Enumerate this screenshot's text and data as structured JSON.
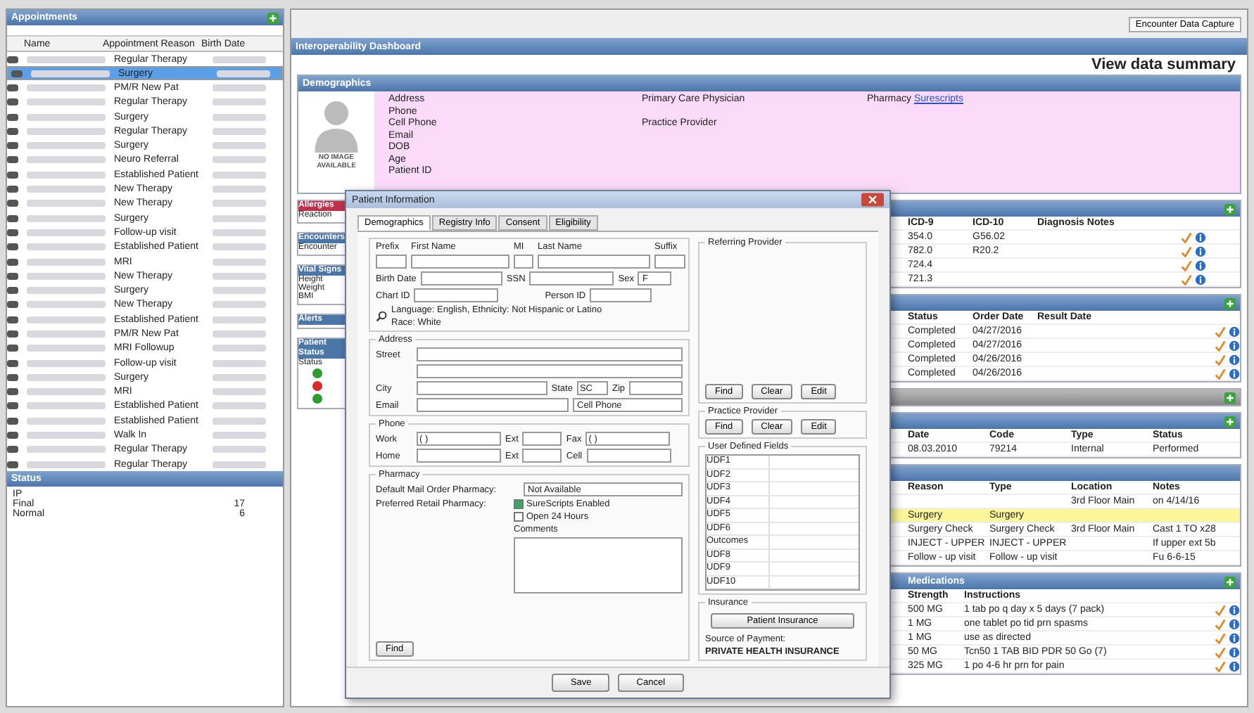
{
  "appointments": {
    "title": "Appointments",
    "columns": [
      "Name",
      "Appointment Reason",
      "Birth Date"
    ],
    "rows": [
      {
        "reason": "Regular Therapy",
        "selected": false
      },
      {
        "reason": "Surgery",
        "selected": true
      },
      {
        "reason": "PM/R New Pat",
        "selected": false
      },
      {
        "reason": "Regular Therapy",
        "selected": false
      },
      {
        "reason": "Surgery",
        "selected": false
      },
      {
        "reason": "Regular Therapy",
        "selected": false
      },
      {
        "reason": "Surgery",
        "selected": false
      },
      {
        "reason": "Neuro Referral",
        "selected": false
      },
      {
        "reason": "Established Patient",
        "selected": false
      },
      {
        "reason": "New Therapy",
        "selected": false
      },
      {
        "reason": "New Therapy",
        "selected": false
      },
      {
        "reason": "Surgery",
        "selected": false
      },
      {
        "reason": "Follow-up visit",
        "selected": false
      },
      {
        "reason": "Established Patient",
        "selected": false
      },
      {
        "reason": "MRI",
        "selected": false
      },
      {
        "reason": "New Therapy",
        "selected": false
      },
      {
        "reason": "Surgery",
        "selected": false
      },
      {
        "reason": "New Therapy",
        "selected": false
      },
      {
        "reason": "Established Patient",
        "selected": false
      },
      {
        "reason": "PM/R New Pat",
        "selected": false
      },
      {
        "reason": "MRI Followup",
        "selected": false
      },
      {
        "reason": "Follow-up visit",
        "selected": false
      },
      {
        "reason": "Surgery",
        "selected": false
      },
      {
        "reason": "MRI",
        "selected": false
      },
      {
        "reason": "Established Patient",
        "selected": false
      },
      {
        "reason": "Established Patient",
        "selected": false
      },
      {
        "reason": "Walk In",
        "selected": false
      },
      {
        "reason": "Regular Therapy",
        "selected": false
      },
      {
        "reason": "Regular Therapy",
        "selected": false
      }
    ]
  },
  "status_panel": {
    "title": "Status",
    "items": [
      {
        "label": "IP"
      },
      {
        "label": "Final",
        "count": "17"
      },
      {
        "label": "Normal",
        "count": "6"
      }
    ]
  },
  "toolbar": {
    "button": "Encounter Data Capture"
  },
  "dashboard": {
    "title": "Interoperability Dashboard",
    "summary_link": "View data summary"
  },
  "demographics": {
    "title": "Demographics",
    "photo_text": "NO IMAGE AVAILABLE",
    "labels": [
      "Address",
      "Phone",
      "Cell Phone",
      "Email",
      "DOB",
      "Age",
      "Patient ID"
    ],
    "primary_care": "Primary Care Physician",
    "practice_provider": "Practice Provider",
    "pharmacy": "Pharmacy",
    "pharmacy_link": "Surescripts"
  },
  "side_panels": [
    {
      "title": "Allergies",
      "color": "#c0304a",
      "lines": [
        "Reaction"
      ]
    },
    {
      "title": "Encounters",
      "color": "#4a76a8",
      "lines": [
        "Encounter"
      ]
    },
    {
      "title": "Vital Signs",
      "color": "#4a76a8",
      "lines": [
        "Height",
        "Weight",
        "BMI"
      ]
    },
    {
      "title": "Alerts",
      "color": "#4a76a8"
    },
    {
      "title": "Patient Status",
      "color": "#4a76a8",
      "lines": [
        "Status"
      ],
      "statuses": [
        {
          "color": "#2e9b2e"
        },
        {
          "color": "#d92b2b"
        },
        {
          "color": "#2e9b2e"
        }
      ]
    }
  ],
  "diagnoses": {
    "columns": [
      "ICD-9",
      "ICD-10",
      "Diagnosis Notes"
    ],
    "rows": [
      [
        "354.0",
        "G56.02"
      ],
      [
        "782.0",
        "R20.2"
      ],
      [
        "724.4",
        ""
      ],
      [
        "721.3",
        ""
      ]
    ]
  },
  "orders": {
    "columns": [
      "Status",
      "Order Date",
      "Result Date"
    ],
    "rows": [
      [
        "Completed",
        "04/27/2016"
      ],
      [
        "Completed",
        "04/27/2016"
      ],
      [
        "Completed",
        "04/26/2016"
      ],
      [
        "Completed",
        "04/26/2016"
      ]
    ]
  },
  "results": {
    "columns": [
      "Date",
      "Code",
      "Type",
      "Status"
    ],
    "rows": [
      [
        "08.03.2010",
        "79214",
        "Internal",
        "Performed"
      ]
    ]
  },
  "visits": {
    "columns": [
      "Reason",
      "Type",
      "Location",
      "Notes"
    ],
    "rows": [
      {
        "cells": [
          "",
          "",
          "3rd Floor Main",
          "on 4/14/16"
        ],
        "highlighted": false
      },
      {
        "cells": [
          "Surgery",
          "Surgery",
          "",
          ""
        ],
        "highlighted": true
      },
      {
        "cells": [
          "Surgery Check",
          "Surgery Check",
          "3rd Floor Main",
          "Cast 1 TO x28"
        ],
        "highlighted": false
      },
      {
        "cells": [
          "INJECT - UPPER",
          "INJECT - UPPER",
          "",
          "If upper ext 5b"
        ],
        "highlighted": false
      },
      {
        "cells": [
          "Follow - up visit",
          "Follow - up visit",
          "",
          "Fu 6-6-15"
        ],
        "highlighted": false
      }
    ]
  },
  "medications": {
    "title": "Medications",
    "columns": [
      "Strength",
      "Instructions"
    ],
    "rows": [
      [
        "500 MG",
        "1 tab po q day x 5 days (7 pack)"
      ],
      [
        "1 MG",
        "one tablet po tid prn spasms"
      ],
      [
        "1 MG",
        "use as directed"
      ],
      [
        "50 MG",
        "Tcn50 1 TAB BID PDR 50 Go (7)"
      ],
      [
        "325 MG",
        "1 po 4-6 hr prn for pain"
      ]
    ]
  },
  "dialog": {
    "title": "Patient Information",
    "tabs": [
      {
        "label": "Demographics",
        "selected": true
      },
      {
        "label": "Registry Info",
        "selected": false
      },
      {
        "label": "Consent",
        "selected": false
      },
      {
        "label": "Eligibility",
        "selected": false
      }
    ],
    "name_labels": [
      "Prefix",
      "First Name",
      "MI",
      "Last Name",
      "Suffix"
    ],
    "birth_date": "Birth Date",
    "ssn": "SSN",
    "sex": "Sex",
    "sex_value": "F",
    "chart_id": "Chart ID",
    "person_id": "Person ID",
    "language_line": "Language: English, Ethnicity: Not Hispanic or Latino",
    "race_line": "Race: White",
    "address": {
      "title": "Address",
      "street": "Street",
      "city": "City",
      "state": "State",
      "state_value": "SC",
      "zip": "Zip",
      "email": "Email",
      "contact": "Cell Phone"
    },
    "phone": {
      "title": "Phone",
      "work": "Work",
      "work_value": "(  )",
      "work_ext": "Ext",
      "home_ext": "Ext",
      "fax": "Fax",
      "fax_value": "(  )",
      "home": "Home",
      "cell": "Cell"
    },
    "pharmacy": {
      "title": "Pharmacy",
      "mail_label": "Default Mail Order Pharmacy:",
      "mail_value": "Not Available",
      "retail_label": "Preferred Retail Pharmacy:",
      "options": [
        {
          "label": "SureScripts Enabled",
          "checked": true
        },
        {
          "label": "Open 24 Hours",
          "checked": false
        }
      ],
      "comments": "Comments",
      "find": "Find"
    },
    "referring": {
      "title": "Referring Provider",
      "buttons": [
        "Find",
        "Clear",
        "Edit"
      ]
    },
    "practice": {
      "title": "Practice Provider",
      "buttons": [
        "Find",
        "Clear",
        "Edit"
      ]
    },
    "udf": {
      "title": "User Defined Fields",
      "items": [
        "UDF1",
        "UDF2",
        "UDF3",
        "UDF4",
        "UDF5",
        "UDF6",
        "Outcomes",
        "UDF8",
        "UDF9",
        "UDF10"
      ]
    },
    "insurance": {
      "title": "Insurance",
      "button": "Patient Insurance",
      "source_label": "Source of Payment:",
      "source_value": "PRIVATE HEALTH INSURANCE"
    },
    "buttons": [
      "Save",
      "Cancel"
    ]
  }
}
